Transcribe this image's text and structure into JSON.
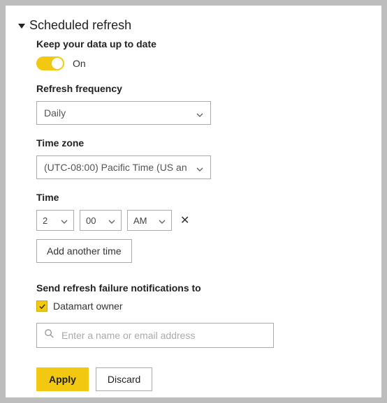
{
  "section": {
    "title": "Scheduled refresh",
    "keep_up_label": "Keep your data up to date",
    "toggle_state": "On"
  },
  "frequency": {
    "label": "Refresh frequency",
    "value": "Daily"
  },
  "timezone": {
    "label": "Time zone",
    "value": "(UTC-08:00) Pacific Time (US an"
  },
  "time": {
    "label": "Time",
    "hour": "2",
    "minute": "00",
    "ampm": "AM",
    "add_another": "Add another time"
  },
  "notifications": {
    "label": "Send refresh failure notifications to",
    "owner_label": "Datamart owner",
    "input_placeholder": "Enter a name or email address"
  },
  "actions": {
    "apply": "Apply",
    "discard": "Discard"
  }
}
